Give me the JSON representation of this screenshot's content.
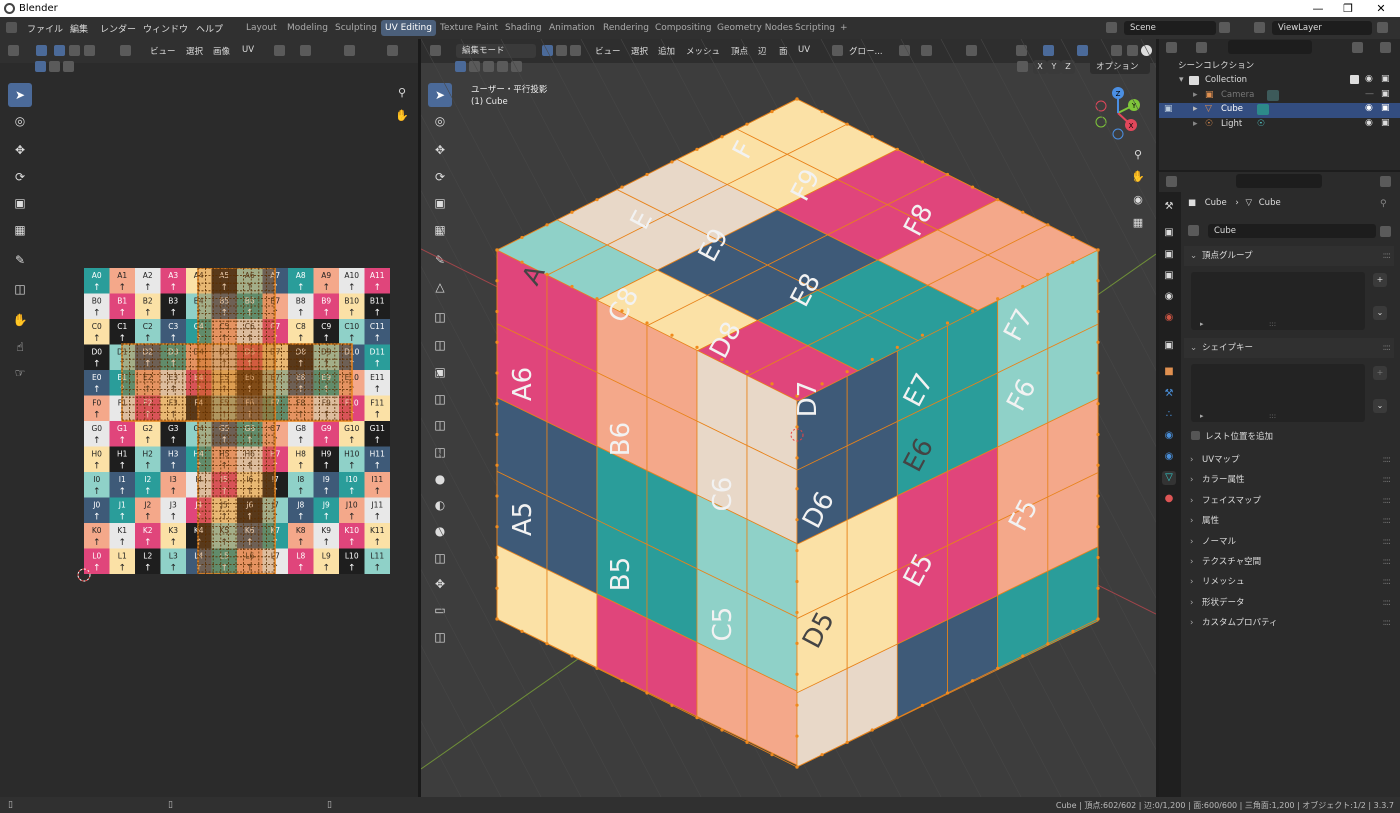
{
  "window": {
    "title": "Blender"
  },
  "menus": [
    "ファイル",
    "編集",
    "レンダー",
    "ウィンドウ",
    "ヘルプ"
  ],
  "workspaces": [
    "Layout",
    "Modeling",
    "Sculpting",
    "UV Editing",
    "Texture Paint",
    "Shading",
    "Animation",
    "Rendering",
    "Compositing",
    "Geometry Nodes",
    "Scripting",
    "+"
  ],
  "active_workspace": "UV Editing",
  "scene": {
    "name": "Scene",
    "view_layer": "ViewLayer"
  },
  "uv_editor": {
    "header_menus": [
      "ビュー",
      "選択",
      "画像",
      "UV"
    ],
    "grid_labels": [
      [
        "A0",
        "A1",
        "A2",
        "A3",
        "A4",
        "A5",
        "A6",
        "A7",
        "A8",
        "A9",
        "A10",
        "A11"
      ],
      [
        "B0",
        "B1",
        "B2",
        "B3",
        "B4",
        "B5",
        "B6",
        "B7",
        "B8",
        "B9",
        "B10",
        "B11"
      ],
      [
        "C0",
        "C1",
        "C2",
        "C3",
        "C4",
        "C5",
        "C6",
        "C7",
        "C8",
        "C9",
        "C10",
        "C11"
      ],
      [
        "D0",
        "D1",
        "D2",
        "D3",
        "D4",
        "D5",
        "D6",
        "D7",
        "D8",
        "D9",
        "D10",
        "D11"
      ],
      [
        "E0",
        "E1",
        "E2",
        "E3",
        "E4",
        "E5",
        "E6",
        "E7",
        "E8",
        "E9",
        "E10",
        "E11"
      ],
      [
        "F0",
        "F1",
        "F2",
        "F3",
        "F4",
        "F5",
        "F6",
        "F7",
        "F8",
        "F9",
        "F10",
        "F11"
      ],
      [
        "G0",
        "G1",
        "G2",
        "G3",
        "G4",
        "G5",
        "G6",
        "G7",
        "G8",
        "G9",
        "G10",
        "G11"
      ],
      [
        "H0",
        "H1",
        "H2",
        "H3",
        "H4",
        "H5",
        "H6",
        "H7",
        "H8",
        "H9",
        "H10",
        "H11"
      ],
      [
        "I0",
        "I1",
        "I2",
        "I3",
        "I4",
        "I5",
        "I6",
        "I7",
        "I8",
        "I9",
        "I10",
        "I11"
      ],
      [
        "J0",
        "J1",
        "J2",
        "J3",
        "J4",
        "J5",
        "J6",
        "J7",
        "J8",
        "J9",
        "J10",
        "J11"
      ],
      [
        "K0",
        "K1",
        "K2",
        "K3",
        "K4",
        "K5",
        "K6",
        "K7",
        "K8",
        "K9",
        "K10",
        "K11"
      ],
      [
        "L0",
        "L1",
        "L2",
        "L3",
        "L4",
        "L5",
        "L6",
        "L7",
        "L8",
        "L9",
        "L10",
        "L11"
      ]
    ],
    "palette": [
      "#2a9d9a",
      "#e0457b",
      "#8fd1c8",
      "#f4a88a",
      "#fbe1a6",
      "#3e5a78",
      "#e8e8e8",
      "#1e1e1e"
    ]
  },
  "viewport": {
    "mode": "編集モード",
    "header_menus": [
      "ビュー",
      "選択",
      "追加",
      "メッシュ",
      "頂点",
      "辺",
      "面",
      "UV"
    ],
    "transform_orientation": "グロー...",
    "options": "オプション",
    "view_name": "ユーザー・平行投影",
    "object_label": "(1) Cube",
    "axis_buttons": [
      "X",
      "Y",
      "Z"
    ],
    "gizmo": {
      "x": "X",
      "y": "Y",
      "z": "Z"
    },
    "face_labels_top": [
      "A",
      "E",
      "F",
      "E9",
      "F9",
      "E8",
      "F8",
      "D8",
      "C8"
    ],
    "face_labels_left": [
      "A6",
      "B6",
      "C6",
      "A5",
      "B5",
      "C5",
      "D7"
    ],
    "face_labels_right": [
      "E7",
      "F7",
      "D6",
      "E6",
      "F6",
      "D5",
      "E5",
      "F5"
    ]
  },
  "outliner": {
    "root": "シーンコレクション",
    "items": [
      {
        "name": "Collection"
      },
      {
        "name": "Camera"
      },
      {
        "name": "Cube"
      },
      {
        "name": "Light"
      }
    ]
  },
  "properties": {
    "breadcrumb_object": "Cube",
    "breadcrumb_mesh": "Cube",
    "mesh_name": "Cube",
    "vertex_groups": "頂点グループ",
    "shape_keys": "シェイプキー",
    "rest_position": "レスト位置を追加",
    "sections": [
      "UVマップ",
      "カラー属性",
      "フェイスマップ",
      "属性",
      "ノーマル",
      "テクスチャ空間",
      "リメッシュ",
      "形状データ",
      "カスタムプロパティ"
    ]
  },
  "status_bar": {
    "text": "Cube | 頂点:602/602 | 辺:0/1,200 | 面:600/600 | 三角面:1,200 | オブジェクト:1/2 | 3.3.7"
  }
}
